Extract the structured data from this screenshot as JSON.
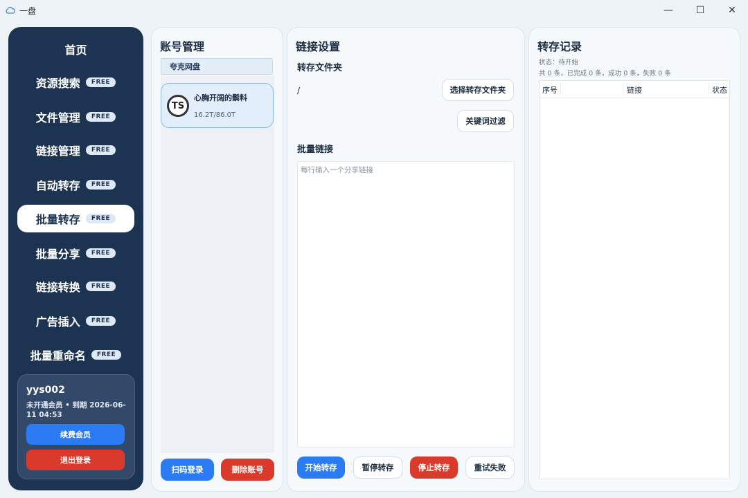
{
  "window": {
    "title": "一盘",
    "minimize": "—",
    "maximize": "☐",
    "close": "✕"
  },
  "sidebar": {
    "items": [
      {
        "label": "首页",
        "badge": ""
      },
      {
        "label": "资源搜索",
        "badge": "FREE"
      },
      {
        "label": "文件管理",
        "badge": "FREE"
      },
      {
        "label": "链接管理",
        "badge": "FREE"
      },
      {
        "label": "自动转存",
        "badge": "FREE"
      },
      {
        "label": "批量转存",
        "badge": "FREE",
        "active": true
      },
      {
        "label": "批量分享",
        "badge": "FREE"
      },
      {
        "label": "链接转换",
        "badge": "FREE"
      },
      {
        "label": "广告插入",
        "badge": "FREE"
      },
      {
        "label": "批量重命名",
        "badge": "FREE"
      }
    ],
    "user": {
      "name": "yys002",
      "status": "未开通会员 • 到期 2026-06-11 04:53",
      "renew_label": "续费会员",
      "logout_label": "退出登录"
    }
  },
  "account_panel": {
    "title": "账号管理",
    "provider_tab": "夸克网盘",
    "accounts": [
      {
        "logo_text": "TS",
        "name": "心胸开阔的鬃料",
        "storage": "16.2T/86.0T"
      }
    ],
    "scan_login_label": "扫码登录",
    "delete_label": "删除账号"
  },
  "link_panel": {
    "title": "链接设置",
    "folder_label": "转存文件夹",
    "folder_path": "/",
    "choose_folder_label": "选择转存文件夹",
    "keyword_filter_label": "关键词过滤",
    "batch_label": "批量链接",
    "batch_value": "",
    "batch_placeholder": "每行输入一个分享链接",
    "start_label": "开始转存",
    "pause_label": "暂停转存",
    "stop_label": "停止转存",
    "retry_label": "重试失败"
  },
  "records_panel": {
    "title": "转存记录",
    "status": "状态：待开始",
    "summary": "共 0 条，已完成 0 条，成功 0 条，失败 0 条",
    "columns": [
      "序号",
      "链接",
      "状态"
    ],
    "rows": []
  },
  "colors": {
    "sidebar_bg": "#1d3352",
    "accent_blue": "#2b7cf4",
    "danger_red": "#d93a2b",
    "app_bg": "#eef3f7"
  }
}
